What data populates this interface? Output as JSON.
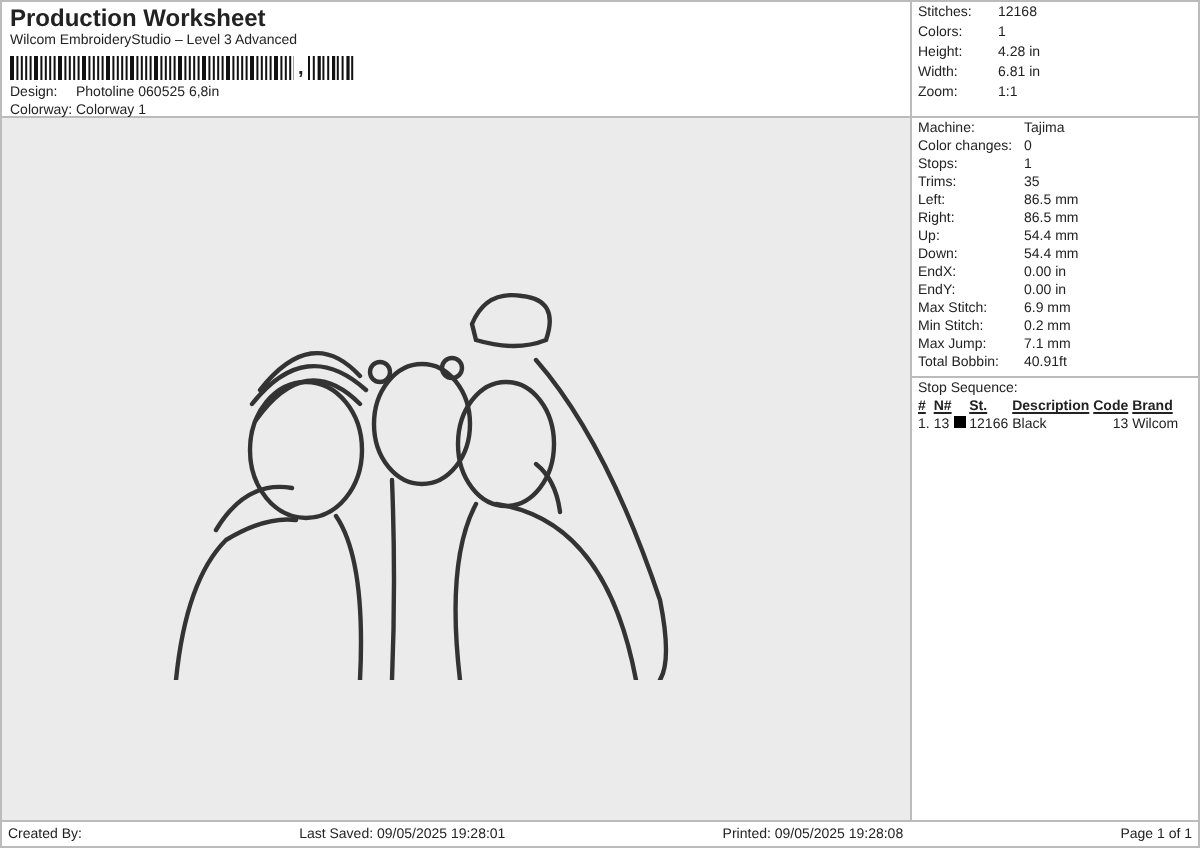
{
  "header": {
    "title": "Production Worksheet",
    "subtitle": "Wilcom EmbroideryStudio – Level 3 Advanced",
    "barcode_suffix": ",",
    "fields": [
      {
        "label": "Design:",
        "value": "Photoline 060525 6,8in"
      },
      {
        "label": "Colorway:",
        "value": "Colorway 1"
      }
    ]
  },
  "summary": [
    {
      "label": "Stitches:",
      "value": "12168"
    },
    {
      "label": "Colors:",
      "value": "1"
    },
    {
      "label": "Height:",
      "value": "4.28 in"
    },
    {
      "label": "Width:",
      "value": "6.81 in"
    },
    {
      "label": "Zoom:",
      "value": "1:1"
    }
  ],
  "details": [
    {
      "label": "Machine:",
      "value": "Tajima"
    },
    {
      "label": "Color changes:",
      "value": "0"
    },
    {
      "label": "Stops:",
      "value": "1"
    },
    {
      "label": "Trims:",
      "value": "35"
    },
    {
      "label": "Left:",
      "value": "86.5 mm"
    },
    {
      "label": "Right:",
      "value": "86.5 mm"
    },
    {
      "label": "Up:",
      "value": "54.4 mm"
    },
    {
      "label": "Down:",
      "value": "54.4 mm"
    },
    {
      "label": "EndX:",
      "value": "0.00 in"
    },
    {
      "label": "EndY:",
      "value": "0.00 in"
    },
    {
      "label": "Max Stitch:",
      "value": "6.9 mm"
    },
    {
      "label": "Min Stitch:",
      "value": "0.2 mm"
    },
    {
      "label": "Max Jump:",
      "value": "7.1 mm"
    },
    {
      "label": "Total Bobbin:",
      "value": "40.91ft"
    }
  ],
  "stop_sequence": {
    "title": "Stop Sequence:",
    "columns": [
      "#",
      "N#",
      "St.",
      "Description",
      "Code",
      "Brand"
    ],
    "rows": [
      {
        "index": "1.",
        "needle": "13",
        "color": "#000000",
        "stitches": "12166",
        "description": "Black",
        "code": "13",
        "brand": "Wilcom"
      }
    ]
  },
  "footer": {
    "created_by": "Created By:",
    "last_saved": "Last Saved: 09/05/2025 19:28:01",
    "printed": "Printed: 09/05/2025 19:28:08",
    "page": "Page 1 of 1"
  }
}
